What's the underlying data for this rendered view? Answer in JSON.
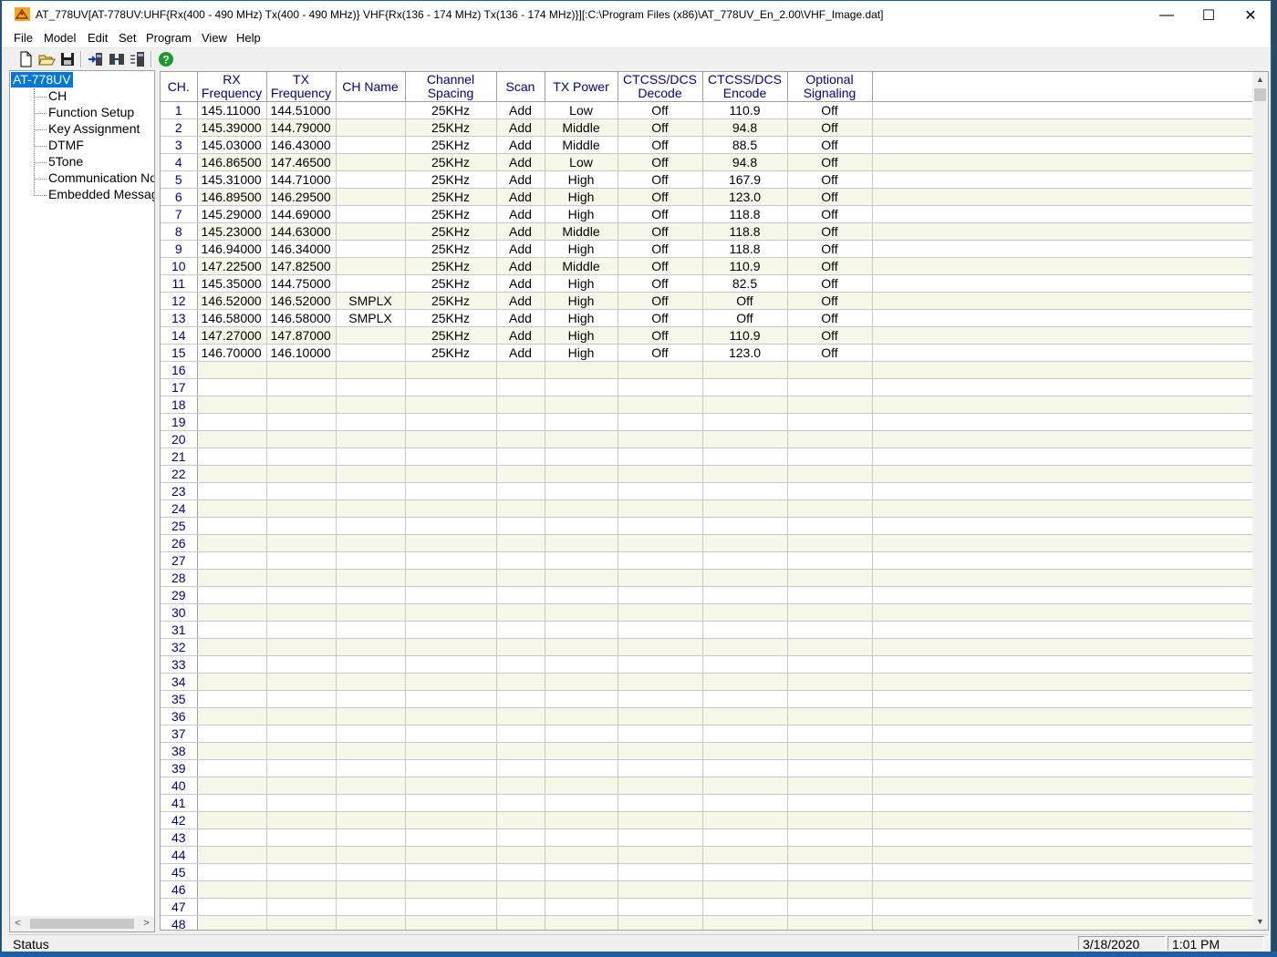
{
  "window": {
    "title": "AT_778UV[AT-778UV:UHF{Rx(400 - 490 MHz) Tx(400 - 490 MHz)} VHF{Rx(136 - 174 MHz) Tx(136 - 174 MHz)}][:C:\\Program Files (x86)\\AT_778UV_En_2.00\\VHF_Image.dat]",
    "minimize": "—",
    "maximize": "☐",
    "close": "✕",
    "app_icon": "antenna-app-icon"
  },
  "menu": [
    "File",
    "Model",
    "Edit",
    "Set",
    "Program",
    "View",
    "Help"
  ],
  "toolbar": {
    "icons": [
      "new-file-icon",
      "open-folder-icon",
      "save-icon",
      "read-from-radio-icon",
      "write-to-radio-icon",
      "radio-info-icon",
      "help-icon"
    ],
    "help_glyph": "?"
  },
  "tree": {
    "root": "AT-778UV",
    "items": [
      "CH",
      "Function Setup",
      "Key Assignment",
      "DTMF",
      "5Tone",
      "Communication Note",
      "Embedded Message"
    ],
    "scroll_left": "<",
    "scroll_right": ">"
  },
  "grid": {
    "headers": [
      {
        "line1": "CH.",
        "line2": ""
      },
      {
        "line1": "RX",
        "line2": "Frequency"
      },
      {
        "line1": "TX",
        "line2": "Frequency"
      },
      {
        "line1": "CH Name",
        "line2": ""
      },
      {
        "line1": "Channel",
        "line2": "Spacing"
      },
      {
        "line1": "Scan",
        "line2": ""
      },
      {
        "line1": "TX Power",
        "line2": ""
      },
      {
        "line1": "CTCSS/DCS",
        "line2": "Decode"
      },
      {
        "line1": "CTCSS/DCS",
        "line2": "Encode"
      },
      {
        "line1": "Optional",
        "line2": "Signaling"
      },
      {
        "line1": "",
        "line2": ""
      }
    ],
    "rows": [
      [
        "1",
        "145.11000",
        "144.51000",
        "",
        "25KHz",
        "Add",
        "Low",
        "Off",
        "110.9",
        "Off"
      ],
      [
        "2",
        "145.39000",
        "144.79000",
        "",
        "25KHz",
        "Add",
        "Middle",
        "Off",
        "94.8",
        "Off"
      ],
      [
        "3",
        "145.03000",
        "146.43000",
        "",
        "25KHz",
        "Add",
        "Middle",
        "Off",
        "88.5",
        "Off"
      ],
      [
        "4",
        "146.86500",
        "147.46500",
        "",
        "25KHz",
        "Add",
        "Low",
        "Off",
        "94.8",
        "Off"
      ],
      [
        "5",
        "145.31000",
        "144.71000",
        "",
        "25KHz",
        "Add",
        "High",
        "Off",
        "167.9",
        "Off"
      ],
      [
        "6",
        "146.89500",
        "146.29500",
        "",
        "25KHz",
        "Add",
        "High",
        "Off",
        "123.0",
        "Off"
      ],
      [
        "7",
        "145.29000",
        "144.69000",
        "",
        "25KHz",
        "Add",
        "High",
        "Off",
        "118.8",
        "Off"
      ],
      [
        "8",
        "145.23000",
        "144.63000",
        "",
        "25KHz",
        "Add",
        "Middle",
        "Off",
        "118.8",
        "Off"
      ],
      [
        "9",
        "146.94000",
        "146.34000",
        "",
        "25KHz",
        "Add",
        "High",
        "Off",
        "118.8",
        "Off"
      ],
      [
        "10",
        "147.22500",
        "147.82500",
        "",
        "25KHz",
        "Add",
        "Middle",
        "Off",
        "110.9",
        "Off"
      ],
      [
        "11",
        "145.35000",
        "144.75000",
        "",
        "25KHz",
        "Add",
        "High",
        "Off",
        "82.5",
        "Off"
      ],
      [
        "12",
        "146.52000",
        "146.52000",
        "SMPLX",
        "25KHz",
        "Add",
        "High",
        "Off",
        "Off",
        "Off"
      ],
      [
        "13",
        "146.58000",
        "146.58000",
        "SMPLX",
        "25KHz",
        "Add",
        "High",
        "Off",
        "Off",
        "Off"
      ],
      [
        "14",
        "147.27000",
        "147.87000",
        "",
        "25KHz",
        "Add",
        "High",
        "Off",
        "110.9",
        "Off"
      ],
      [
        "15",
        "146.70000",
        "146.10000",
        "",
        "25KHz",
        "Add",
        "High",
        "Off",
        "123.0",
        "Off"
      ],
      [
        "16",
        "",
        "",
        "",
        "",
        "",
        "",
        "",
        "",
        ""
      ],
      [
        "17",
        "",
        "",
        "",
        "",
        "",
        "",
        "",
        "",
        ""
      ],
      [
        "18",
        "",
        "",
        "",
        "",
        "",
        "",
        "",
        "",
        ""
      ],
      [
        "19",
        "",
        "",
        "",
        "",
        "",
        "",
        "",
        "",
        ""
      ],
      [
        "20",
        "",
        "",
        "",
        "",
        "",
        "",
        "",
        "",
        ""
      ],
      [
        "21",
        "",
        "",
        "",
        "",
        "",
        "",
        "",
        "",
        ""
      ],
      [
        "22",
        "",
        "",
        "",
        "",
        "",
        "",
        "",
        "",
        ""
      ],
      [
        "23",
        "",
        "",
        "",
        "",
        "",
        "",
        "",
        "",
        ""
      ],
      [
        "24",
        "",
        "",
        "",
        "",
        "",
        "",
        "",
        "",
        ""
      ],
      [
        "25",
        "",
        "",
        "",
        "",
        "",
        "",
        "",
        "",
        ""
      ],
      [
        "26",
        "",
        "",
        "",
        "",
        "",
        "",
        "",
        "",
        ""
      ],
      [
        "27",
        "",
        "",
        "",
        "",
        "",
        "",
        "",
        "",
        ""
      ],
      [
        "28",
        "",
        "",
        "",
        "",
        "",
        "",
        "",
        "",
        ""
      ],
      [
        "29",
        "",
        "",
        "",
        "",
        "",
        "",
        "",
        "",
        ""
      ],
      [
        "30",
        "",
        "",
        "",
        "",
        "",
        "",
        "",
        "",
        ""
      ],
      [
        "31",
        "",
        "",
        "",
        "",
        "",
        "",
        "",
        "",
        ""
      ],
      [
        "32",
        "",
        "",
        "",
        "",
        "",
        "",
        "",
        "",
        ""
      ],
      [
        "33",
        "",
        "",
        "",
        "",
        "",
        "",
        "",
        "",
        ""
      ],
      [
        "34",
        "",
        "",
        "",
        "",
        "",
        "",
        "",
        "",
        ""
      ],
      [
        "35",
        "",
        "",
        "",
        "",
        "",
        "",
        "",
        "",
        ""
      ],
      [
        "36",
        "",
        "",
        "",
        "",
        "",
        "",
        "",
        "",
        ""
      ],
      [
        "37",
        "",
        "",
        "",
        "",
        "",
        "",
        "",
        "",
        ""
      ],
      [
        "38",
        "",
        "",
        "",
        "",
        "",
        "",
        "",
        "",
        ""
      ],
      [
        "39",
        "",
        "",
        "",
        "",
        "",
        "",
        "",
        "",
        ""
      ],
      [
        "40",
        "",
        "",
        "",
        "",
        "",
        "",
        "",
        "",
        ""
      ],
      [
        "41",
        "",
        "",
        "",
        "",
        "",
        "",
        "",
        "",
        ""
      ],
      [
        "42",
        "",
        "",
        "",
        "",
        "",
        "",
        "",
        "",
        ""
      ],
      [
        "43",
        "",
        "",
        "",
        "",
        "",
        "",
        "",
        "",
        ""
      ],
      [
        "44",
        "",
        "",
        "",
        "",
        "",
        "",
        "",
        "",
        ""
      ],
      [
        "45",
        "",
        "",
        "",
        "",
        "",
        "",
        "",
        "",
        ""
      ],
      [
        "46",
        "",
        "",
        "",
        "",
        "",
        "",
        "",
        "",
        ""
      ],
      [
        "47",
        "",
        "",
        "",
        "",
        "",
        "",
        "",
        "",
        ""
      ],
      [
        "48",
        "",
        "",
        "",
        "",
        "",
        "",
        "",
        "",
        ""
      ]
    ],
    "scroll_up": "▲",
    "scroll_down": "▼"
  },
  "status": {
    "text": "Status",
    "date": "3/18/2020",
    "time": "1:01 PM"
  },
  "colors": {
    "header_text": "#00008b",
    "row_alt": "#f7f7e9",
    "selection": "#0078d7",
    "help_green": "#1a9a2a"
  }
}
